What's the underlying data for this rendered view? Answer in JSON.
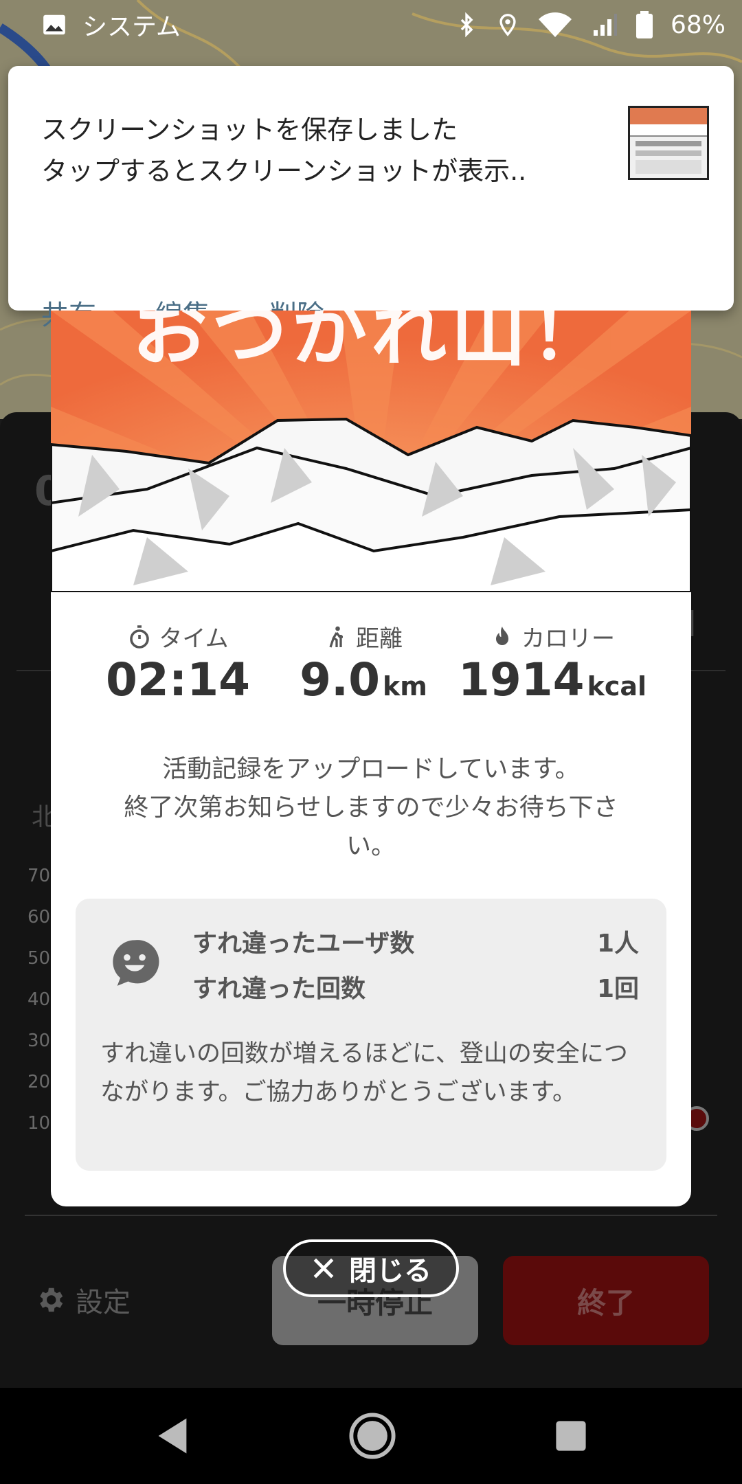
{
  "status_bar": {
    "app_label": "システム",
    "battery": "68%"
  },
  "notification": {
    "title": "スクリーンショットを保存しました",
    "text": "タップするとスクリーンショットが表示..",
    "actions": [
      "共有",
      "編集",
      "削除"
    ]
  },
  "modal": {
    "hero_title": "おつかれ山！",
    "stats": [
      {
        "label": "タイム",
        "value": "02:14",
        "unit": "",
        "icon": "stopwatch-icon"
      },
      {
        "label": "距離",
        "value": "9.0",
        "unit": "km",
        "icon": "hiker-icon"
      },
      {
        "label": "カロリー",
        "value": "1914",
        "unit": "kcal",
        "icon": "flame-icon"
      }
    ],
    "upload_message_lines": [
      "活動記録をアップロードしています。",
      "終了次第お知らせしますので少々お待ち下さ",
      "い。"
    ],
    "passing": {
      "users_label": "すれ違ったユーザ数",
      "users_value": "1人",
      "count_label": "すれ違った回数",
      "count_value": "1回",
      "note": "すれ違いの回数が増えるほどに、登山の安全につながります。ご協力ありがとうございます。"
    }
  },
  "close_button": {
    "label": "閉じる"
  },
  "background_app": {
    "settings_label": "設定",
    "pause_label": "一時停止",
    "end_label": "終了",
    "axis_ticks": [
      "70",
      "60",
      "50",
      "40",
      "30",
      "20",
      "10"
    ]
  }
}
